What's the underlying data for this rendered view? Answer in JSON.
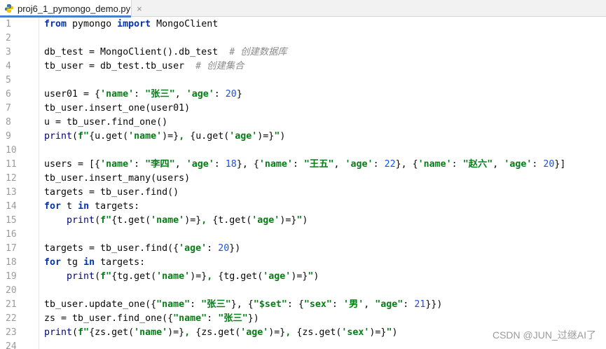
{
  "tab": {
    "filename": "proj6_1_pymongo_demo.py",
    "close_glyph": "×"
  },
  "line_numbers": [
    "1",
    "2",
    "3",
    "4",
    "5",
    "6",
    "7",
    "8",
    "9",
    "10",
    "11",
    "12",
    "13",
    "14",
    "15",
    "16",
    "17",
    "18",
    "19",
    "20",
    "21",
    "22",
    "23",
    "24"
  ],
  "code": {
    "l1": {
      "a": "from",
      "b": " pymongo ",
      "c": "import",
      "d": " MongoClient"
    },
    "l3": {
      "a": "db_test = MongoClient().db_test  ",
      "b": "# 创建数据库"
    },
    "l4": {
      "a": "tb_user = db_test.tb_user  ",
      "b": "# 创建集合"
    },
    "l6": {
      "a": "user01 = {",
      "b": "'name'",
      "c": ": ",
      "d": "\"张三\"",
      "e": ", ",
      "f": "'age'",
      "g": ": ",
      "h": "20",
      "i": "}"
    },
    "l7": {
      "a": "tb_user.insert_one(user01)"
    },
    "l8": {
      "a": "u = tb_user.find_one()"
    },
    "l9": {
      "a": "print",
      "b": "(",
      "c": "f\"",
      "d": "{u.get(",
      "e": "'name'",
      "f": ")=}",
      "g": ", ",
      "h": "{u.get(",
      "i": "'age'",
      "j": ")=}",
      "k": "\"",
      "l": ")"
    },
    "l11": {
      "a": "users = [{",
      "b": "'name'",
      "c": ": ",
      "d": "\"李四\"",
      "e": ", ",
      "f": "'age'",
      "g": ": ",
      "h": "18",
      "i": "}, {",
      "j": "'name'",
      "k": ": ",
      "l": "\"王五\"",
      "m": ", ",
      "n": "'age'",
      "o": ": ",
      "p": "22",
      "q": "}, {",
      "r": "'name'",
      "s": ": ",
      "t": "\"赵六\"",
      "u": ", ",
      "v": "'age'",
      "w": ": ",
      "x": "20",
      "y": "}]"
    },
    "l12": {
      "a": "tb_user.insert_many(users)"
    },
    "l13": {
      "a": "targets = tb_user.find()"
    },
    "l14": {
      "a": "for",
      "b": " t ",
      "c": "in",
      "d": " targets:"
    },
    "l15": {
      "a": "    ",
      "b": "print",
      "c": "(",
      "d": "f\"",
      "e": "{t.get(",
      "f": "'name'",
      "g": ")=}",
      "h": ", ",
      "i": "{t.get(",
      "j": "'age'",
      "k": ")=}",
      "l": "\"",
      "m": ")"
    },
    "l17": {
      "a": "targets = tb_user.find({",
      "b": "'age'",
      "c": ": ",
      "d": "20",
      "e": "})"
    },
    "l18": {
      "a": "for",
      "b": " tg ",
      "c": "in",
      "d": " targets:"
    },
    "l19": {
      "a": "    ",
      "b": "print",
      "c": "(",
      "d": "f\"",
      "e": "{tg.get(",
      "f": "'name'",
      "g": ")=}",
      "h": ", ",
      "i": "{tg.get(",
      "j": "'age'",
      "k": ")=}",
      "l": "\"",
      "m": ")"
    },
    "l21": {
      "a": "tb_user.update_one({",
      "b": "\"name\"",
      "c": ": ",
      "d": "\"张三\"",
      "e": "}, {",
      "f": "\"$set\"",
      "g": ": {",
      "h": "\"sex\"",
      "i": ": ",
      "j": "'男'",
      "k": ", ",
      "l": "\"age\"",
      "m": ": ",
      "n": "21",
      "o": "}})"
    },
    "l22": {
      "a": "zs = tb_user.find_one({",
      "b": "\"name\"",
      "c": ": ",
      "d": "\"张三\"",
      "e": "})"
    },
    "l23": {
      "a": "print",
      "b": "(",
      "c": "f\"",
      "d": "{zs.get(",
      "e": "'name'",
      "f": ")=}",
      "g": ", ",
      "h": "{zs.get(",
      "i": "'age'",
      "j": ")=}",
      "k": ", ",
      "l": "{zs.get(",
      "m": "'sex'",
      "n": ")=}",
      "o": "\"",
      "p": ")"
    }
  },
  "watermark": "CSDN @JUN_过继AI了",
  "colors": {
    "keyword": "#0033b3",
    "string": "#067d17",
    "number": "#1750eb",
    "comment": "#8c8c8c",
    "tab_accent": "#4a7fd0"
  }
}
